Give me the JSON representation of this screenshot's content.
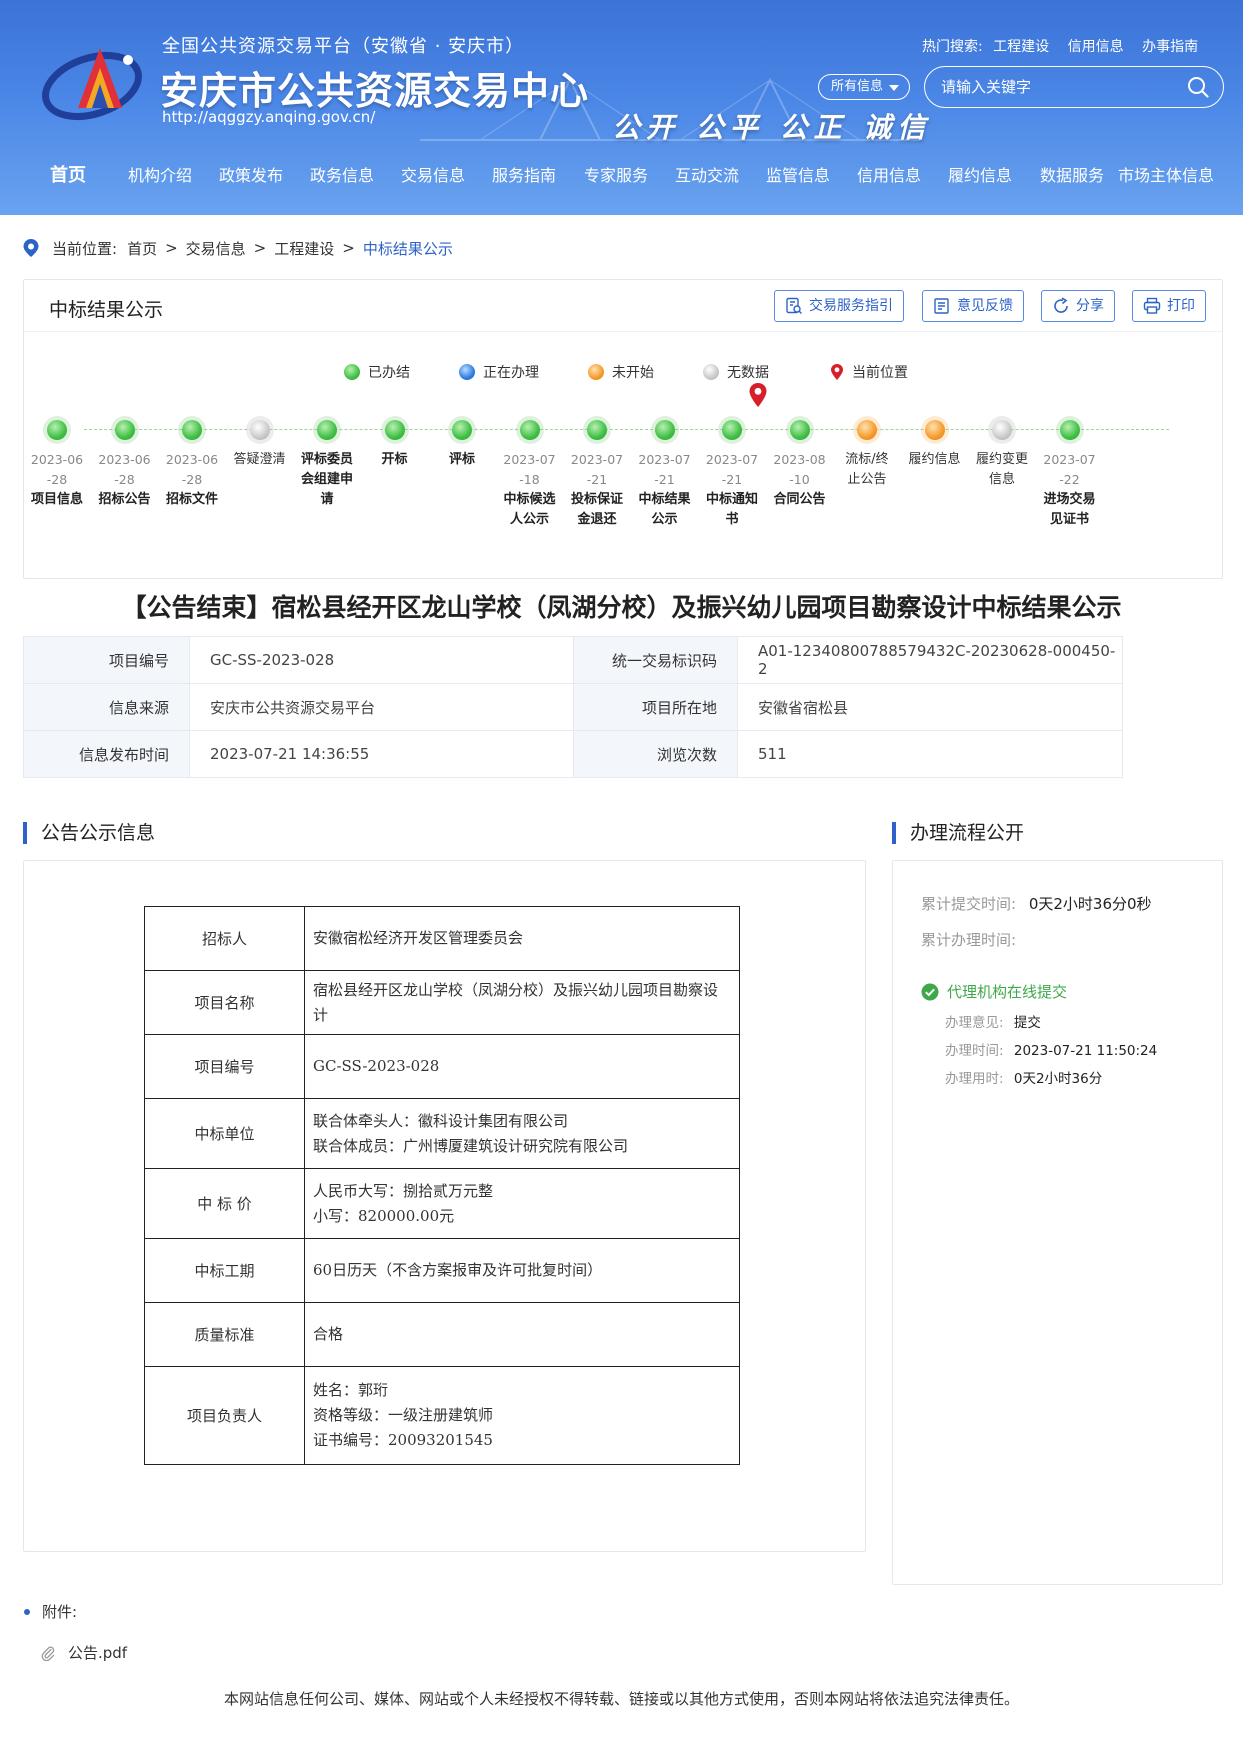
{
  "header": {
    "subtitle": "全国公共资源交易平台（安徽省 · 安庆市）",
    "title": "安庆市公共资源交易中心",
    "url": "http://aqggzy.anqing.gov.cn/",
    "slogan": "公开 公平 公正 诚信",
    "hot_label": "热门搜索:",
    "hot_links": [
      "工程建设",
      "信用信息",
      "办事指南"
    ],
    "scope": "所有信息",
    "search_placeholder": "请输入关键字"
  },
  "nav": [
    "首页",
    "机构介绍",
    "政策发布",
    "政务信息",
    "交易信息",
    "服务指南",
    "专家服务",
    "互动交流",
    "监管信息",
    "信用信息",
    "履约信息",
    "数据服务",
    "市场主体信息"
  ],
  "breadcrumb": {
    "label": "当前位置:",
    "items": [
      "首页",
      "交易信息",
      "工程建设"
    ],
    "current": "中标结果公示"
  },
  "progress": {
    "title": "中标结果公示",
    "buttons": [
      "交易服务指引",
      "意见反馈",
      "分享",
      "打印"
    ],
    "legend": [
      "已办结",
      "正在办理",
      "未开始",
      "无数据",
      "当前位置"
    ],
    "steps": [
      {
        "date": "2023-06-28",
        "name": "项目信息",
        "status": "done"
      },
      {
        "date": "2023-06-28",
        "name": "招标公告",
        "status": "done"
      },
      {
        "date": "2023-06-28",
        "name": "招标文件",
        "status": "done"
      },
      {
        "date": "",
        "name": "答疑澄清",
        "status": "none"
      },
      {
        "date": "",
        "name": "评标委员会组建申请",
        "status": "done"
      },
      {
        "date": "",
        "name": "开标",
        "status": "done"
      },
      {
        "date": "",
        "name": "评标",
        "status": "done"
      },
      {
        "date": "2023-07-18",
        "name": "中标候选人公示",
        "status": "done"
      },
      {
        "date": "2023-07-21",
        "name": "投标保证金退还",
        "status": "done"
      },
      {
        "date": "2023-07-21",
        "name": "中标结果公示",
        "status": "done"
      },
      {
        "date": "2023-07-21",
        "name": "中标通知书",
        "status": "done"
      },
      {
        "date": "2023-08-10",
        "name": "合同公告",
        "status": "done"
      },
      {
        "date": "",
        "name": "流标/终止公告",
        "status": "todo"
      },
      {
        "date": "",
        "name": "履约信息",
        "status": "todo"
      },
      {
        "date": "",
        "name": "履约变更信息",
        "status": "none"
      },
      {
        "date": "2023-07-22",
        "name": "进场交易见证书",
        "status": "done"
      }
    ]
  },
  "notice_title": "【公告结束】宿松县经开区龙山学校（凤湖分校）及振兴幼儿园项目勘察设计中标结果公示",
  "info": {
    "project_no_label": "项目编号",
    "project_no": "GC-SS-2023-028",
    "trade_id_label": "统一交易标识码",
    "trade_id": "A01-12340800788579432C-20230628-000450-2",
    "source_label": "信息来源",
    "source": "安庆市公共资源交易平台",
    "location_label": "项目所在地",
    "location": "安徽省宿松县",
    "publish_label": "信息发布时间",
    "publish": "2023-07-21 14:36:55",
    "views_label": "浏览次数",
    "views": "511"
  },
  "notice_section": {
    "title": "公告公示信息",
    "rows": [
      {
        "key": "招标人",
        "lines": [
          "安徽宿松经济开发区管理委员会"
        ]
      },
      {
        "key": "项目名称",
        "lines": [
          "宿松县经开区龙山学校（凤湖分校）及振兴幼儿园项目勘察设计"
        ]
      },
      {
        "key": "项目编号",
        "lines": [
          "GC-SS-2023-028"
        ]
      },
      {
        "key": "中标单位",
        "lines": [
          "联合体牵头人：徽科设计集团有限公司",
          "联合体成员：广州博厦建筑设计研究院有限公司"
        ]
      },
      {
        "key": "中 标 价",
        "lines": [
          "人民币大写：捌拾贰万元整",
          "小写：820000.00元"
        ]
      },
      {
        "key": "中标工期",
        "lines": [
          "60日历天（不含方案报审及许可批复时间）"
        ]
      },
      {
        "key": "质量标准",
        "lines": [
          "合格"
        ]
      },
      {
        "key": "项目负责人",
        "lines": [
          "姓名：郭珩",
          "资格等级：一级注册建筑师",
          "证书编号：20093201545"
        ]
      }
    ]
  },
  "flow_section": {
    "title": "办理流程公开",
    "submit_label": "累计提交时间:",
    "submit_value": "0天2小时36分0秒",
    "handle_label": "累计办理时间:",
    "handle_value": "",
    "step_name": "代理机构在线提交",
    "opinion_label": "办理意见:",
    "opinion": "提交",
    "time_label": "办理时间:",
    "time": "2023-07-21 11:50:24",
    "duration_label": "办理用时:",
    "duration": "0天2小时36分"
  },
  "attachments": {
    "label": "附件:",
    "files": [
      "公告.pdf"
    ]
  },
  "footer": "本网站信息任何公司、媒体、网站或个人未经授权不得转载、链接或以其他方式使用，否则本网站将依法追究法律责任。",
  "colors": {
    "brand": "#2d63c8",
    "header": "#4a86e6",
    "done": "#3fbf44",
    "doing": "#2f7de0",
    "todo": "#f59a2a",
    "none": "#c9c9c9",
    "pin": "#d81e2a"
  }
}
